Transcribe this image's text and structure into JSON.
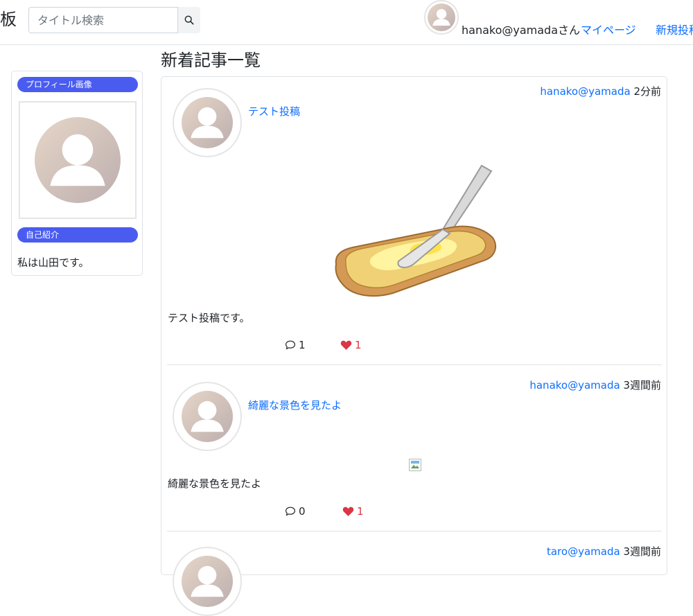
{
  "header": {
    "brand": "板",
    "search_placeholder": "タイトル検索",
    "user_label": "hanako@yamadaさん",
    "mypage_label": "マイページ",
    "new_post_label": "新規投稿"
  },
  "sidebar": {
    "profile_image_label": "プロフィール画像",
    "bio_heading": "自己紹介",
    "bio_text": "私は山田です。"
  },
  "main": {
    "title": "新着記事一覧",
    "posts": [
      {
        "author": "hanako@yamada",
        "time": "2分前",
        "title": "テスト投稿",
        "body": "テスト投稿です。",
        "comments": "1",
        "likes": "1",
        "image": "butter-toast"
      },
      {
        "author": "hanako@yamada",
        "time": "3週間前",
        "title": "綺麗な景色を見たよ",
        "body": "綺麗な景色を見たよ",
        "comments": "0",
        "likes": "1",
        "image": "broken-image"
      },
      {
        "author": "taro@yamada",
        "time": "3週間前"
      }
    ]
  },
  "colors": {
    "link": "#0d6efd",
    "pill": "#4a5cf0",
    "like": "#dc3545",
    "border": "#dee2e6"
  }
}
